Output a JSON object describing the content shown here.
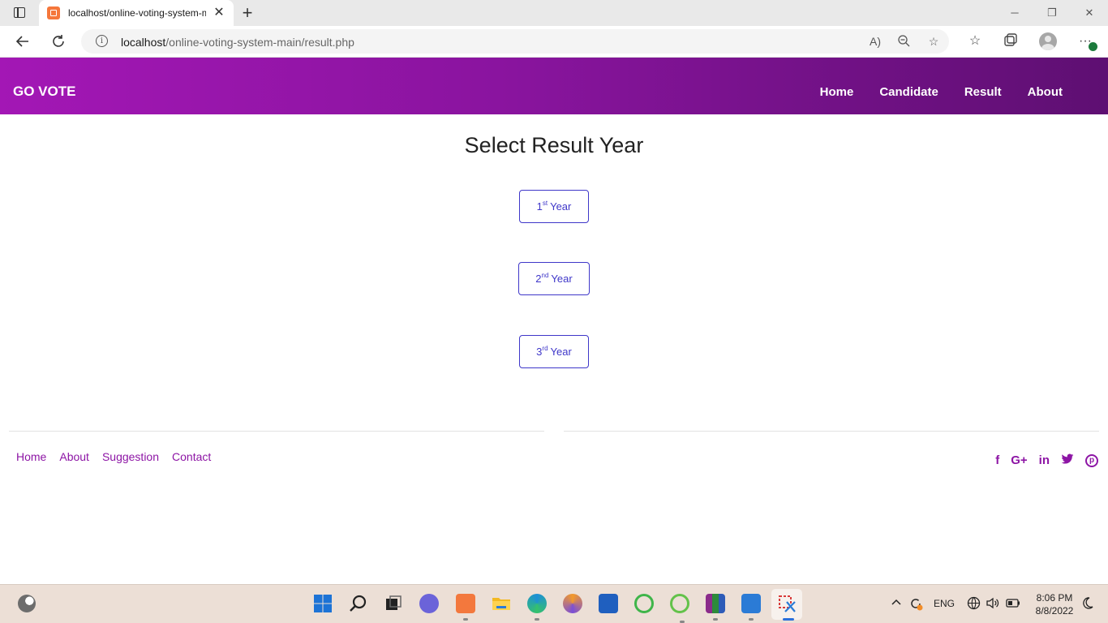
{
  "browser": {
    "tab_title": "localhost/online-voting-system-main/result.php",
    "tab_close": "✕",
    "new_tab": "+",
    "window_controls": [
      "─",
      "❐",
      "✕"
    ],
    "url_host": "localhost",
    "url_path": "/online-voting-system-main/result.php",
    "icons": {
      "back": "back-arrow-icon",
      "reload": "reload-icon",
      "info": "site-info-icon",
      "read_aloud": "read-aloud-icon",
      "zoom": "zoom-out-icon",
      "add_favorite": "add-favorite-icon",
      "favorites": "favorites-icon",
      "collections": "collections-icon",
      "profile": "profile-avatar-icon",
      "menu": "more-menu-icon"
    }
  },
  "site": {
    "brand": "GO VOTE",
    "nav": [
      "Home",
      "Candidate",
      "Result",
      "About"
    ],
    "header_gradient": [
      "#a317b5",
      "#5e0f72"
    ]
  },
  "main": {
    "title": "Select Result Year",
    "years": [
      {
        "num": "1",
        "sup": "st",
        "label": "Year"
      },
      {
        "num": "2",
        "sup": "nd",
        "label": "Year"
      },
      {
        "num": "3",
        "sup": "rd",
        "label": "Year"
      }
    ],
    "button_color": "#3f37c9"
  },
  "footer": {
    "links": [
      "Home",
      "About",
      "Suggestion",
      "Contact"
    ],
    "social": [
      {
        "icon": "facebook-icon",
        "glyph": "f"
      },
      {
        "icon": "google-plus-icon",
        "glyph": "G+"
      },
      {
        "icon": "linkedin-icon",
        "glyph": "in"
      },
      {
        "icon": "twitter-icon",
        "glyph": "🐦"
      },
      {
        "icon": "pinterest-icon",
        "glyph": "p"
      }
    ],
    "accent": "#8d15a5"
  },
  "taskbar": {
    "language": "ENG",
    "time": "8:06 PM",
    "date": "8/8/2022",
    "apps": [
      "start-icon",
      "search-icon",
      "task-view-icon",
      "chat-icon",
      "xampp-icon",
      "file-explorer-icon",
      "edge-icon",
      "vpn-icon",
      "store-icon",
      "app-green-1-icon",
      "app-green-2-icon",
      "winrar-icon",
      "notepad-icon",
      "snipping-tool-icon"
    ]
  }
}
